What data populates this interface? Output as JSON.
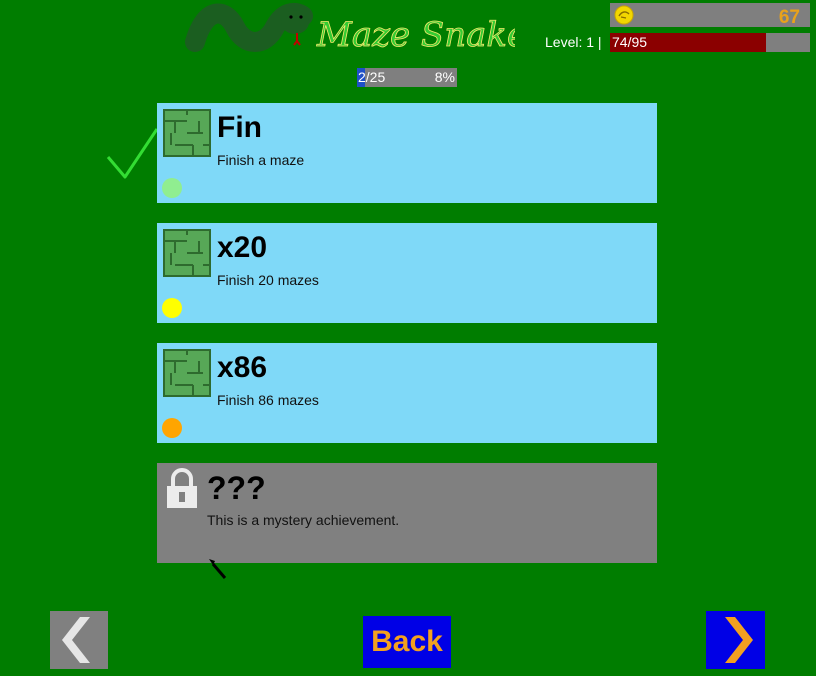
{
  "header": {
    "logo_text": "Maze Snake",
    "coins": "67",
    "level_label": "Level: 1 |",
    "xp_text": "74/95",
    "xp_fraction": 0.779
  },
  "progress": {
    "count": "2/25",
    "percent": "8%",
    "fraction": 0.08
  },
  "achievements": [
    {
      "title": "Fin",
      "description": "Finish a maze",
      "tier_color": "#90ee90",
      "completed": true
    },
    {
      "title": "x20",
      "description": "Finish 20 mazes",
      "tier_color": "#ffff00",
      "completed": false
    },
    {
      "title": "x86",
      "description": "Finish 86 mazes",
      "tier_color": "#ffa500",
      "completed": false
    },
    {
      "title": "???",
      "description": "This is a mystery achievement.",
      "locked": true
    }
  ],
  "nav": {
    "back_label": "Back",
    "prev_icon": "chevron-left-icon",
    "next_icon": "chevron-right-icon"
  },
  "colors": {
    "background": "#007d00",
    "card": "#7fd9f8",
    "card_locked": "#808080",
    "coin_text": "#e8a21c",
    "xp_fill": "#8b0000",
    "progress_fill": "#1e50c8",
    "back_text": "#f2a020"
  }
}
